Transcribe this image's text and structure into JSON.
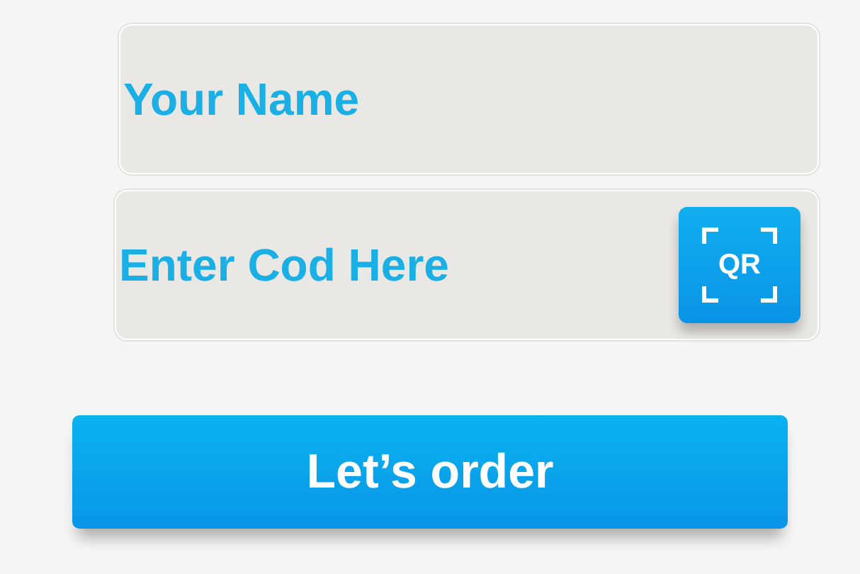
{
  "fields": [
    {
      "placeholder": "Your Name"
    },
    {
      "placeholder": "Enter Cod Here",
      "scan_button": "QR"
    }
  ],
  "order_button": "Let’s order"
}
